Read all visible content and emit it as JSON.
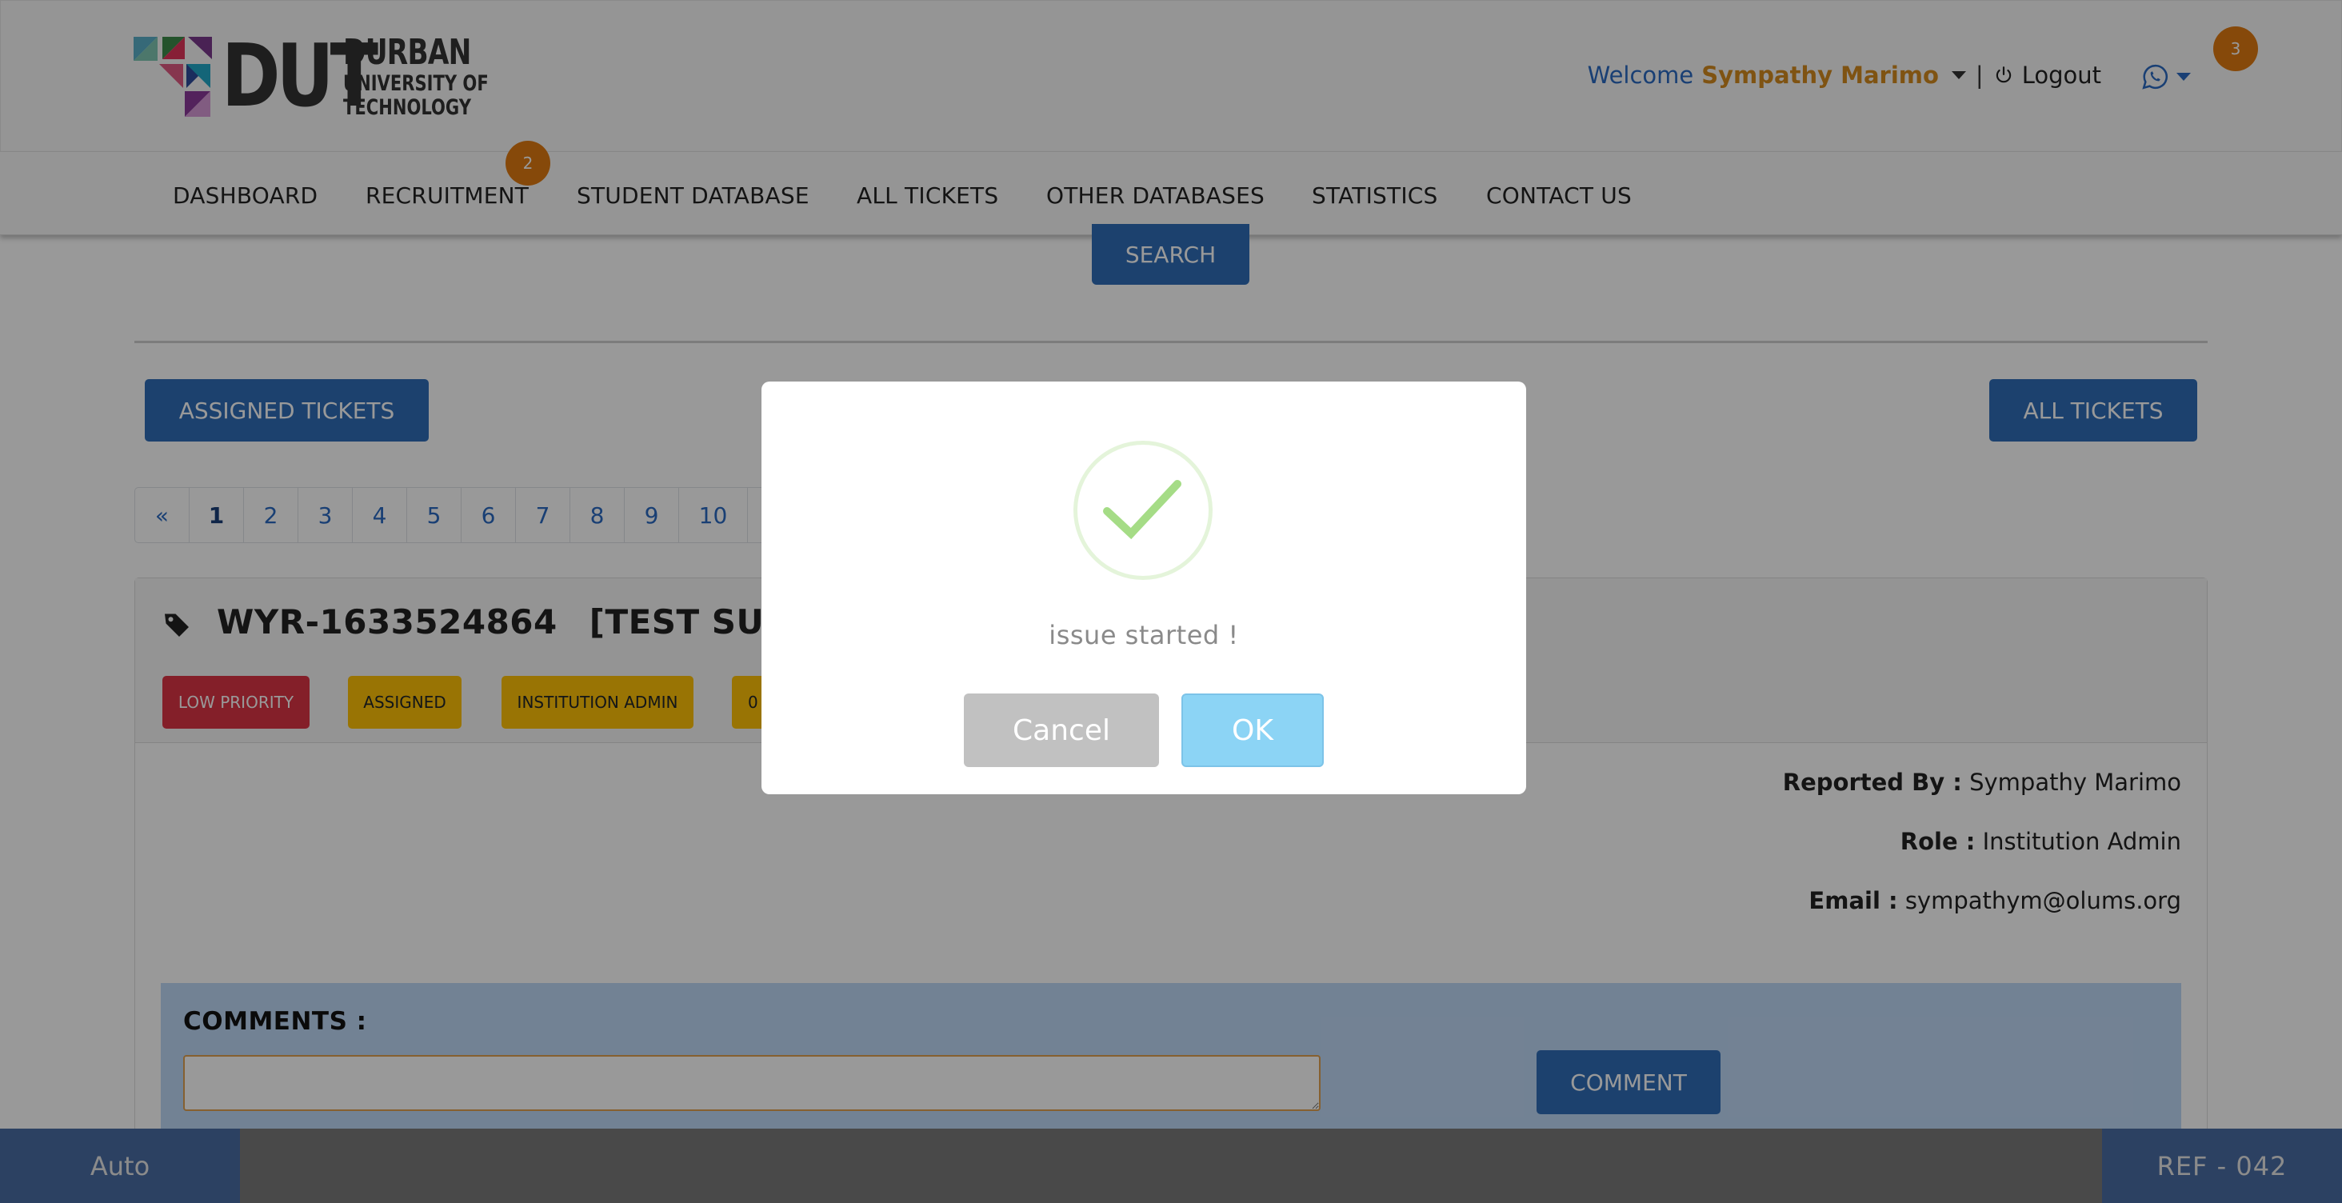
{
  "header": {
    "logo": {
      "mark": "DUT",
      "line1": "DURBAN",
      "line2": "UNIVERSITY OF",
      "line3": "TECHNOLOGY"
    },
    "welcome": "Welcome",
    "user_name": "Sympathy Marimo",
    "separator": "|",
    "logout_label": "Logout",
    "whatsapp_badge": "3"
  },
  "nav": {
    "items": [
      "DASHBOARD",
      "RECRUITMENT",
      "STUDENT DATABASE",
      "ALL TICKETS",
      "OTHER DATABASES",
      "STATISTICS",
      "CONTACT US"
    ],
    "recruitment_badge": "2"
  },
  "search": {
    "button_label": "SEARCH"
  },
  "toolbar": {
    "assigned_label": "ASSIGNED TICKETS",
    "all_label": "ALL TICKETS"
  },
  "pagination": {
    "prev": "«",
    "pages": [
      "1",
      "2",
      "3",
      "4",
      "5",
      "6",
      "7",
      "8",
      "9",
      "10"
    ],
    "active_page": "1"
  },
  "ticket": {
    "id": "WYR-1633524864",
    "subject_partial": "[TEST SUB",
    "badges": [
      "LOW PRIORITY",
      "ASSIGNED",
      "INSTITUTION ADMIN",
      "0"
    ],
    "reported_by_label": "Reported By :",
    "reported_by_value": "Sympathy Marimo",
    "role_label": "Role :",
    "role_value": "Institution Admin",
    "email_label": "Email :",
    "email_value": "sympathym@olums.org"
  },
  "comments": {
    "label": "COMMENTS :",
    "input_value": "",
    "button_label": "COMMENT"
  },
  "footer": {
    "left": "Auto",
    "right": "REF - 042"
  },
  "modal": {
    "message": "issue started !",
    "cancel_label": "Cancel",
    "ok_label": "OK"
  },
  "colors": {
    "primary": "#2f6db8",
    "accent": "#e07b12",
    "danger": "#dc3545",
    "warning": "#ffc107",
    "success": "#a5dc86"
  }
}
